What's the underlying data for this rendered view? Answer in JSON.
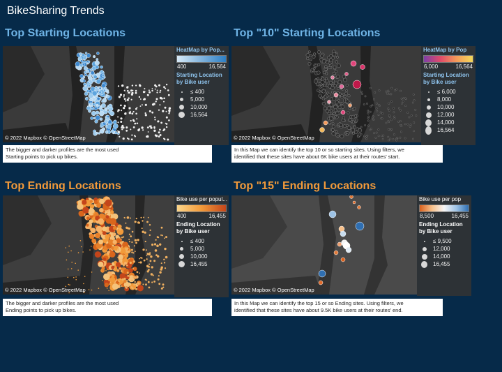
{
  "dashboard_title": "BikeSharing Trends",
  "attribution": "© 2022 Mapbox  © OpenStreetMap",
  "panels": {
    "top_start": {
      "title": "Top Starting Locations",
      "legend_title": "HeatMap by Pop...",
      "range_min": "400",
      "range_max": "16,564",
      "size_title": "Starting Location by Bike user",
      "sizes": [
        "≤ 400",
        "5,000",
        "10,000",
        "16,564"
      ],
      "caption_1": "The bigger and darker profiles are the most used",
      "caption_2": "Starting points to pick up bikes."
    },
    "top10_start": {
      "title": "Top \"10\" Starting Locations",
      "legend_title": "HeatMap by Pop",
      "range_min": "6,000",
      "range_max": "16,564",
      "size_title": "Starting Location by Bike user",
      "sizes": [
        "≤ 6,000",
        "8,000",
        "10,000",
        "12,000",
        "14,000",
        "16,564"
      ],
      "caption_1": "In this Map we can identify the top 10 or so starting sites. Using filters, we",
      "caption_2": "identified that these sites have about 6K bike users at their routes' start."
    },
    "top_end": {
      "title": "Top Ending Locations",
      "legend_title": "Bike use per popul...",
      "range_min": "400",
      "range_max": "16,455",
      "size_title": "Ending Location by Bike user",
      "sizes": [
        "≤ 400",
        "5,000",
        "10,000",
        "16,455"
      ],
      "caption_1": "The bigger and darker profiles are the most used",
      "caption_2": "Ending points to pick up bikes."
    },
    "top15_end": {
      "title": "Top \"15\" Ending Locations",
      "legend_title": "Bike use per pop",
      "range_min": "8,500",
      "range_max": "16,455",
      "size_title": "Ending Location by Bike user",
      "sizes": [
        "≤ 9,500",
        "12,000",
        "14,000",
        "16,455"
      ],
      "caption_1": "In this Map we can identify the top 15 or so Ending sites. Using filters, we",
      "caption_2": "identified that these sites have about 9.5K bike users at their routes' end."
    }
  },
  "colors": {
    "background": "#062a49",
    "title_blue": "#6fb4e6",
    "title_orange": "#f29a3a",
    "map_land": "#3a3a3a",
    "map_water": "#222222",
    "legend_bg": "#2d3236"
  }
}
